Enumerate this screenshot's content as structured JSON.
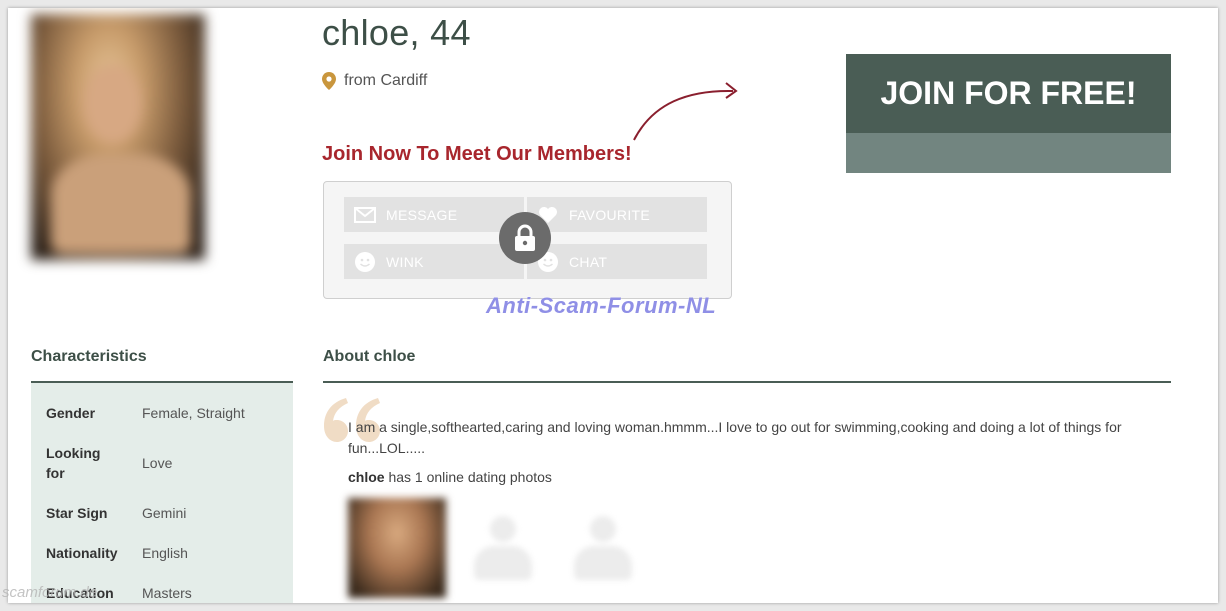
{
  "profile": {
    "title": "chloe, 44",
    "location": "from Cardiff"
  },
  "cta": {
    "join_heading": "Join Now To Meet Our Members!",
    "join_button": "JOIN FOR FREE!"
  },
  "actions": [
    {
      "label": "MESSAGE",
      "icon": "envelope-icon"
    },
    {
      "label": "FAVOURITE",
      "icon": "heart-icon"
    },
    {
      "label": "WINK",
      "icon": "smiley-icon"
    },
    {
      "label": "CHAT",
      "icon": "smiley-icon"
    }
  ],
  "watermark": "Anti-Scam-Forum-NL",
  "corner_watermark": "scamforum.de",
  "characteristics": {
    "heading": "Characteristics",
    "rows": [
      {
        "key": "Gender",
        "value": "Female, Straight"
      },
      {
        "key": "Looking for",
        "value": "Love"
      },
      {
        "key": "Star Sign",
        "value": "Gemini"
      },
      {
        "key": "Nationality",
        "value": "English"
      },
      {
        "key": "Education",
        "value": "Masters"
      }
    ]
  },
  "about": {
    "heading": "About chloe",
    "text": "I am a single,softhearted,caring and loving woman.hmmm...I love to go out for swimming,cooking and doing a lot of things for fun...LOL.....",
    "photos_name": "chloe",
    "photos_text": " has 1 online dating photos"
  },
  "colors": {
    "brand_dark": "#4a5d55",
    "brand_light": "#728580",
    "accent_red": "#a8262d",
    "table_bg": "#e4ede9"
  }
}
